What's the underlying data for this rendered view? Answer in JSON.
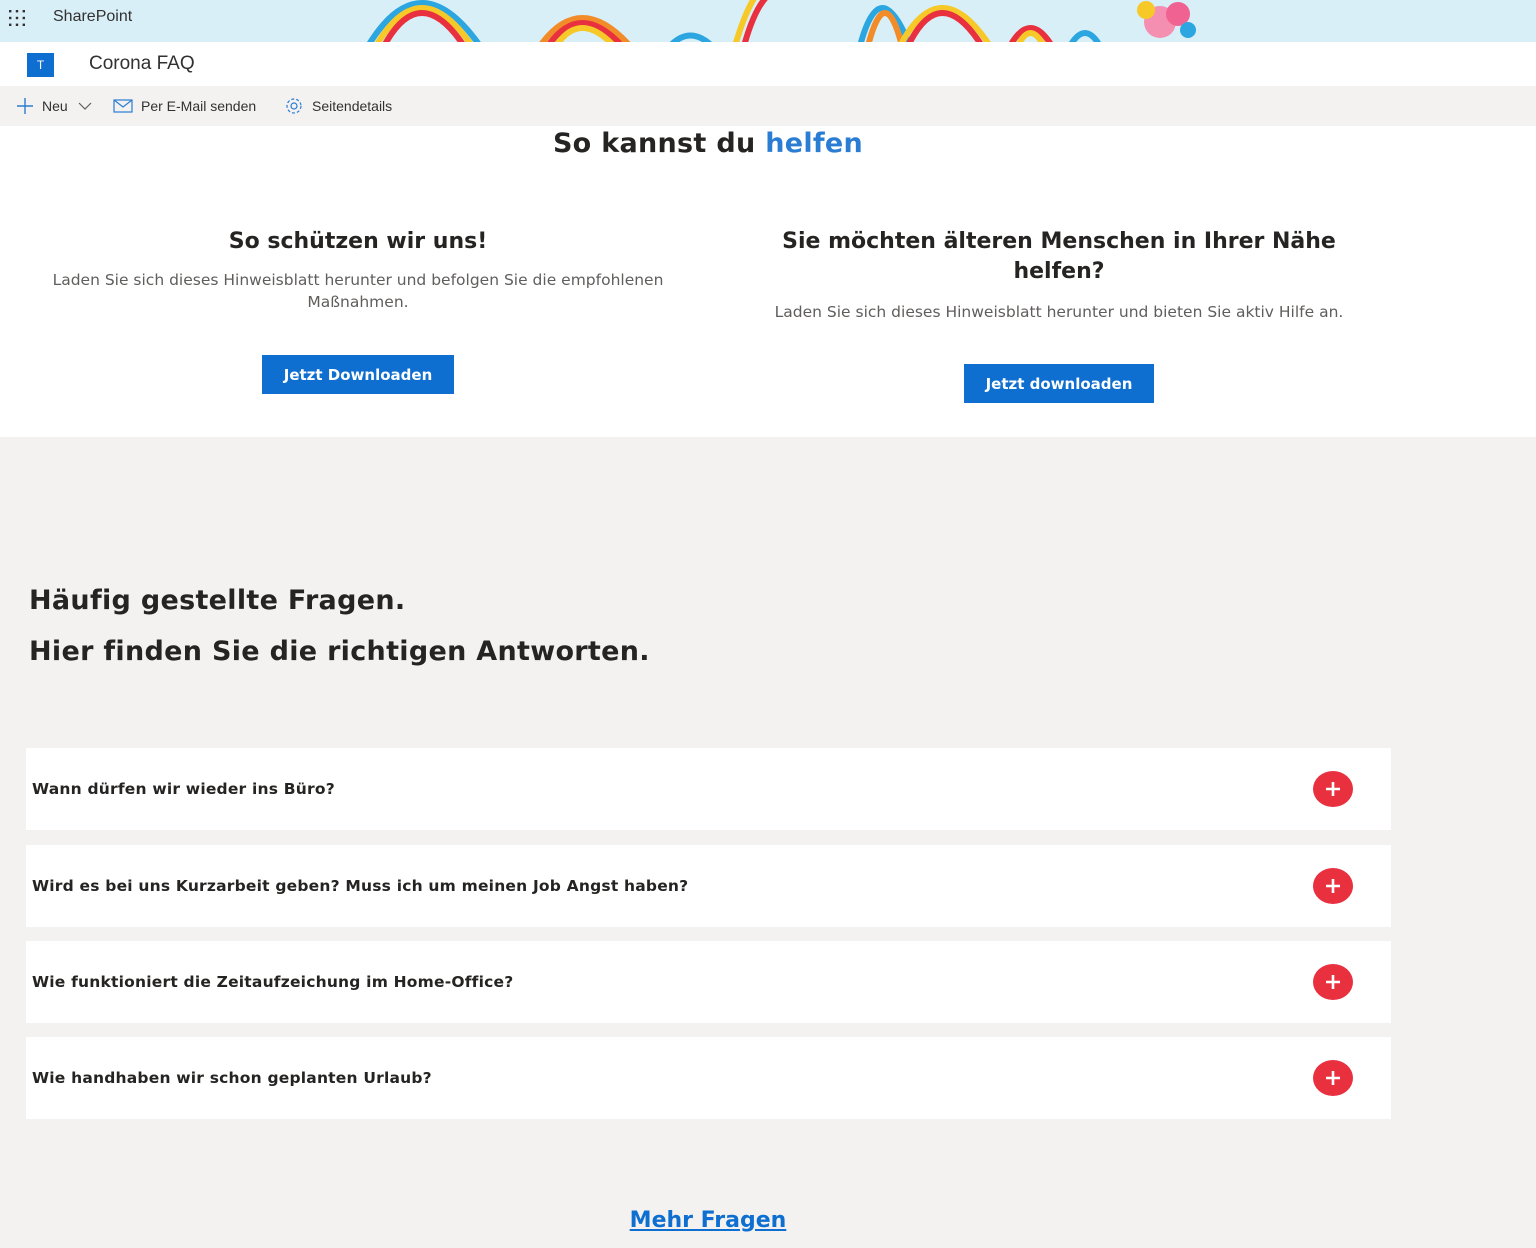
{
  "suite_bar": {
    "app_name": "SharePoint",
    "icons": [
      "app-launcher-icon"
    ]
  },
  "site": {
    "logo_letter": "T",
    "title": "Corona FAQ"
  },
  "command_bar": {
    "new_label": "Neu",
    "email_label": "Per E-Mail senden",
    "details_label": "Seitendetails",
    "icons": [
      "plus-icon",
      "chevron-down-icon",
      "mail-icon",
      "gear-icon"
    ]
  },
  "help": {
    "title_part1": "So kannst du ",
    "title_accent": "helfen",
    "accent_color": "#2b7cd3",
    "cards": [
      {
        "heading": "So schützen wir uns!",
        "text_line1": "Laden Sie sich dieses Hinweisblatt herunter und befolgen Sie die empfohlenen",
        "text_line2": "Maßnahmen.",
        "button_label": "Jetzt Downloaden"
      },
      {
        "heading_line1": "Sie möchten älteren Menschen in Ihrer Nähe",
        "heading_line2": "helfen?",
        "text": "Laden Sie sich dieses Hinweisblatt herunter und bieten Sie aktiv Hilfe an.",
        "button_label": "Jetzt downloaden"
      }
    ],
    "button_color": "#0f6fd1"
  },
  "faq": {
    "heading1": "Häufig gestellte Fragen.",
    "heading2": "Hier finden Sie die richtigen Antworten.",
    "items": [
      {
        "question": "Wann dürfen wir wieder ins Büro?"
      },
      {
        "question": "Wird es bei uns Kurzarbeit geben? Muss ich um meinen Job Angst haben?"
      },
      {
        "question": "Wie funktioniert die Zeitaufzeichung im Home-Office?"
      },
      {
        "question": "Wie handhaben wir schon geplanten Urlaub?"
      }
    ],
    "toggle_color": "#e8303f",
    "more_link": "Mehr Fragen"
  }
}
